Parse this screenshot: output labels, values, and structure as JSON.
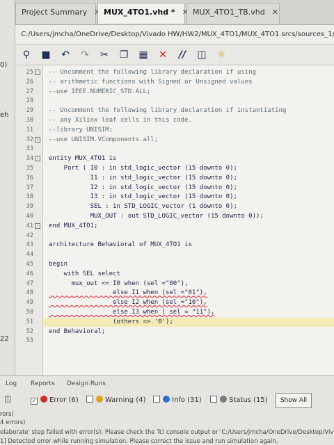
{
  "tabs": [
    {
      "label": "Project Summary",
      "active": false
    },
    {
      "label": "MUX_4TO1.vhd *",
      "active": true
    },
    {
      "label": "MUX_4TO1_TB.vhd",
      "active": false
    }
  ],
  "path": "C:/Users/jmcha/OneDrive/Desktop/Vivado HW/HW2/MUX_4TO1/MUX_4TO1.srcs/sources_1/n",
  "toolbar_icons": [
    "search-icon",
    "save-icon",
    "undo-icon",
    "redo-icon",
    "cut-icon",
    "copy-icon",
    "paste-icon",
    "delete-icon",
    "comment-icon",
    "columns-icon",
    "bulb-icon"
  ],
  "code_lines": [
    {
      "n": "25",
      "text": "-- Uncomment the following library declaration if using",
      "comment": true,
      "fold": "minus"
    },
    {
      "n": "26",
      "text": "-- arithmetic functions with Signed or Unsigned values",
      "comment": true
    },
    {
      "n": "27",
      "text": "--use IEEE.NUMERIC_STD.ALL;",
      "comment": true
    },
    {
      "n": "28",
      "text": ""
    },
    {
      "n": "29",
      "text": "-- Uncomment the following library declaration if instantiating",
      "comment": true
    },
    {
      "n": "30",
      "text": "-- any Xilinx leaf cells in this code.",
      "comment": true
    },
    {
      "n": "31",
      "text": "--library UNISIM;",
      "comment": true
    },
    {
      "n": "32",
      "text": "--use UNISIM.VComponents.all;",
      "comment": true,
      "fold": "minus"
    },
    {
      "n": "33",
      "text": ""
    },
    {
      "n": "34",
      "text": "entity MUX_4TO1 is",
      "fold": "minus"
    },
    {
      "n": "35",
      "text": "    Port ( I0 : in std_logic_vector (15 downto 0);"
    },
    {
      "n": "36",
      "text": "           I1 : in std_logic_vector (15 downto 0);"
    },
    {
      "n": "37",
      "text": "           I2 : in std_logic_vector (15 downto 0);"
    },
    {
      "n": "38",
      "text": "           I3 : in std_logic_vector (15 downto 0);"
    },
    {
      "n": "39",
      "text": "           SEL : in STD_LOGIC_vector (1 downto 0);"
    },
    {
      "n": "40",
      "text": "           MUX_OUT : out STD_LOGIC_vector (15 downto 0));"
    },
    {
      "n": "41",
      "text": "end MUX_4TO1;",
      "fold": "minus"
    },
    {
      "n": "42",
      "text": ""
    },
    {
      "n": "43",
      "text": "architecture Behavioral of MUX_4TO1 is"
    },
    {
      "n": "44",
      "text": ""
    },
    {
      "n": "45",
      "text": "begin"
    },
    {
      "n": "46",
      "text": "    with SEL select"
    },
    {
      "n": "47",
      "text": "      mux_out <= I0 when (sel =\"00\"),"
    },
    {
      "n": "48",
      "text": "                 else I1 when (sel =\"01\"),",
      "error": true
    },
    {
      "n": "49",
      "text": "                 else I2 when (sel =\"10\"),",
      "error": true
    },
    {
      "n": "50",
      "text": "                 else I3 when ( sel = \"11\"),",
      "error": true
    },
    {
      "n": "51",
      "text": "                 (others => '0');",
      "current": true
    },
    {
      "n": "52",
      "text": "end Behavioral;"
    },
    {
      "n": "53",
      "text": ""
    }
  ],
  "bottom": {
    "tabs": [
      "Log",
      "Reports",
      "Design Runs"
    ],
    "filters": [
      {
        "label": "Error (6)",
        "checked": true,
        "color": "#d32b2b"
      },
      {
        "label": "Warning (4)",
        "checked": false,
        "color": "#e0a020"
      },
      {
        "label": "Info (31)",
        "checked": false,
        "color": "#2a6fd0"
      },
      {
        "label": "Status (15)",
        "checked": false,
        "color": "#7a7a7a"
      }
    ],
    "show_all": "Show All",
    "messages": [
      "rors)",
      "4 errors)",
      "elaborate' step failed with error(s). Please check the Tcl console output or 'C:/Users/jmcha/OneDrive/Desktop/Vivado",
      "1] Detected error while running simulation. Please correct the issue and run simulation again."
    ]
  },
  "left_fragments": [
    "0)",
    "eh",
    "22"
  ]
}
